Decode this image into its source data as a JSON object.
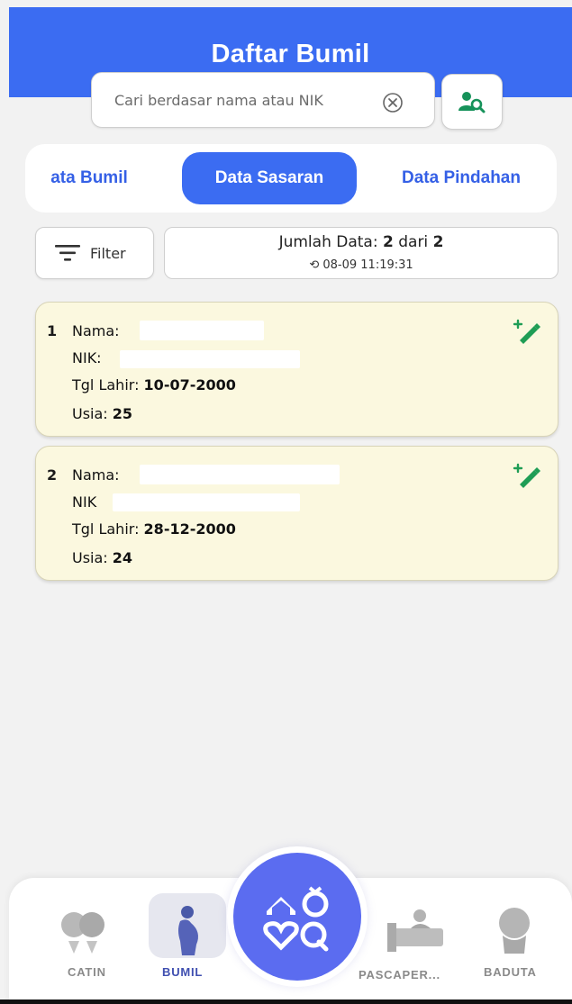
{
  "header": {
    "title": "Daftar Bumil",
    "search_placeholder": "Cari berdasar nama atau NIK"
  },
  "tabs": [
    {
      "label": "ata Bumil",
      "active": false
    },
    {
      "label": "Data Sasaran",
      "active": true
    },
    {
      "label": "Data Pindahan",
      "active": false
    }
  ],
  "filter": {
    "label": "Filter"
  },
  "summary": {
    "count_label": "Jumlah Data:",
    "count_value": "2",
    "count_of": "dari",
    "count_total": "2",
    "sync_time": "08-09 11:19:31"
  },
  "records": [
    {
      "no": "1",
      "nama_label": "Nama:",
      "nik_label": "NIK:",
      "tgl_label": "Tgl Lahir:",
      "tgl_value": "10-07-2000",
      "usia_label": "Usia:",
      "usia_value": "25"
    },
    {
      "no": "2",
      "nama_label": "Nama:",
      "nik_label": "NIK",
      "tgl_label": "Tgl Lahir:",
      "tgl_value": "28-12-2000",
      "usia_label": "Usia:",
      "usia_value": "24"
    }
  ],
  "nav": [
    {
      "label": "CATIN",
      "icon": "couple-icon"
    },
    {
      "label": "BUMIL",
      "icon": "pregnant-icon",
      "active": true
    },
    {
      "label": "",
      "icon": "home-ring-icon",
      "center": true
    },
    {
      "label": "PASCAPER...",
      "icon": "mother-bed-icon"
    },
    {
      "label": "BADUTA",
      "icon": "baby-icon"
    }
  ],
  "colors": {
    "primary": "#3b6cf2",
    "card_bg": "#fbf8df",
    "edit_green": "#1f9d55",
    "fab": "#5b6cf0"
  }
}
